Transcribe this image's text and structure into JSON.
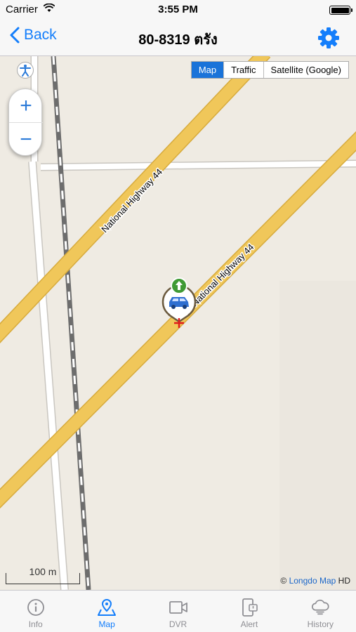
{
  "status_bar": {
    "carrier": "Carrier",
    "time": "3:55 PM"
  },
  "nav": {
    "back_label": "Back",
    "title": "80-8319 ตรัง",
    "settings_icon": "gear-icon"
  },
  "map": {
    "map_types": [
      {
        "label": "Map",
        "active": true
      },
      {
        "label": "Traffic",
        "active": false
      },
      {
        "label": "Satellite (Google)",
        "active": false
      }
    ],
    "zoom_in": "+",
    "zoom_out": "−",
    "road_labels": [
      "National Highway 44",
      "National Highway 44"
    ],
    "scale_label": "100 m",
    "attribution": {
      "prefix": "©",
      "link": "Longdo Map",
      "suffix": "HD"
    },
    "vehicle_icon": "car-icon",
    "heading_icon": "arrow-up-icon"
  },
  "tabbar": {
    "items": [
      {
        "label": "Info",
        "icon": "info-icon",
        "active": false
      },
      {
        "label": "Map",
        "icon": "map-pin-icon",
        "active": true
      },
      {
        "label": "DVR",
        "icon": "video-camera-icon",
        "active": false
      },
      {
        "label": "Alert",
        "icon": "alert-phone-icon",
        "active": false
      },
      {
        "label": "History",
        "icon": "cloud-history-icon",
        "active": false
      }
    ]
  },
  "colors": {
    "accent": "#147efb",
    "road": "#f0c75a",
    "map_bg": "#efebe3",
    "active_maptype": "#1a73d9"
  }
}
